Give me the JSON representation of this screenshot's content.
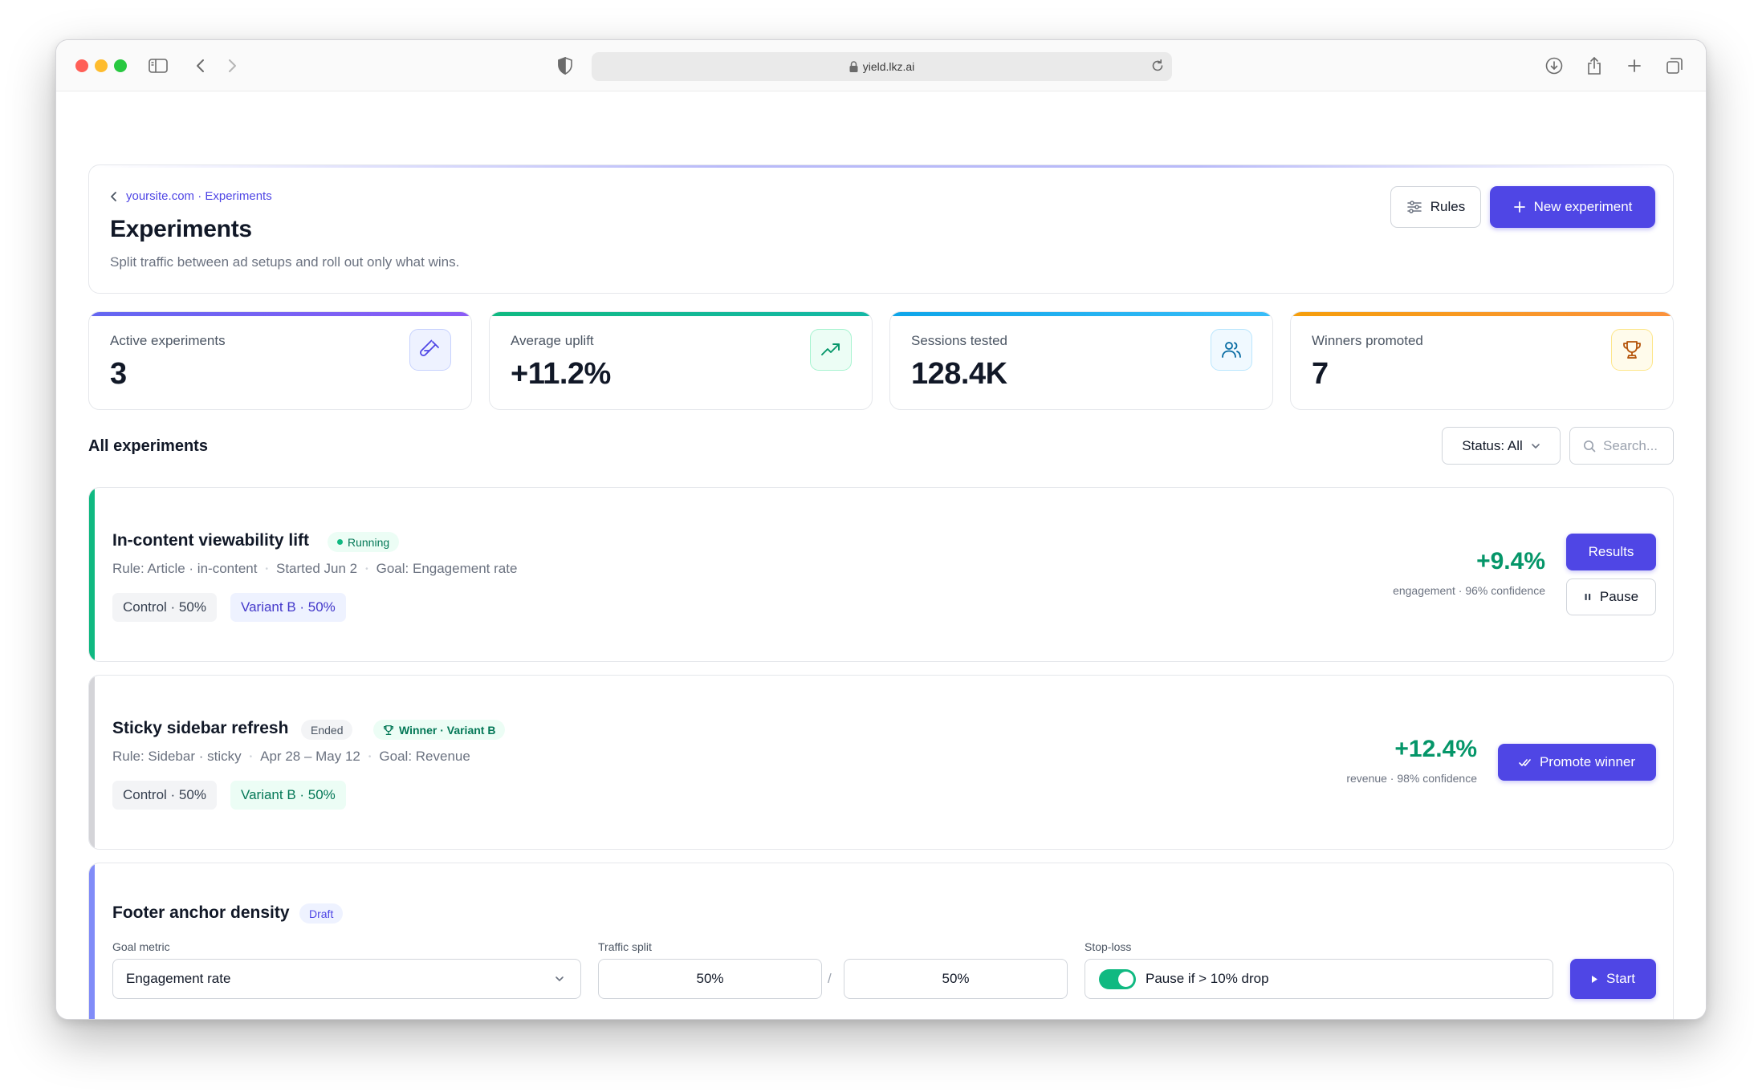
{
  "browser": {
    "url": "yield.lkz.ai"
  },
  "header": {
    "breadcrumb": "yoursite.com · Experiments",
    "title": "Experiments",
    "subtitle": "Split traffic between ad setups and roll out only what wins.",
    "rules_label": "Rules",
    "new_label": "New experiment"
  },
  "stats": [
    {
      "label": "Active experiments",
      "value": "3",
      "icon": "flask-icon"
    },
    {
      "label": "Average uplift",
      "value": "+11.2%",
      "icon": "trending-up-icon"
    },
    {
      "label": "Sessions tested",
      "value": "128.4K",
      "icon": "users-icon"
    },
    {
      "label": "Winners promoted",
      "value": "7",
      "icon": "trophy-icon"
    }
  ],
  "list": {
    "title": "All experiments",
    "status_filter": "Status: All",
    "search_placeholder": "Search..."
  },
  "experiments": [
    {
      "title": "In-content viewability lift",
      "badge": "Running",
      "meta": [
        "Rule: Article · in-content",
        "Started Jun 2",
        "Goal: Engagement rate"
      ],
      "control": "Control · 50%",
      "variant": "Variant B · 50%",
      "uplift": "+9.4%",
      "uplift_sub": "engagement · 96% confidence",
      "primary_action": "Results",
      "secondary_action": "Pause"
    },
    {
      "title": "Sticky sidebar refresh",
      "badge": "Ended",
      "winner_badge": "Winner · Variant B",
      "meta": [
        "Rule: Sidebar · sticky",
        "Apr 28 – May 12",
        "Goal: Revenue"
      ],
      "control": "Control · 50%",
      "variant": "Variant B · 50%",
      "uplift": "+12.4%",
      "uplift_sub": "revenue · 98% confidence",
      "primary_action": "Promote winner"
    },
    {
      "title": "Footer anchor density",
      "badge": "Draft",
      "goal_label": "Goal metric",
      "goal_value": "Engagement rate",
      "split_label": "Traffic split",
      "split_a": "50%",
      "split_divider": "/",
      "split_b": "50%",
      "stoploss_label": "Stop-loss",
      "stoploss_value": "Pause if > 10% drop",
      "stoploss_enabled": true,
      "primary_action": "Start"
    }
  ],
  "colors": {
    "accent": "#4f46e5",
    "success": "#10b981",
    "uplift": "#059669"
  }
}
